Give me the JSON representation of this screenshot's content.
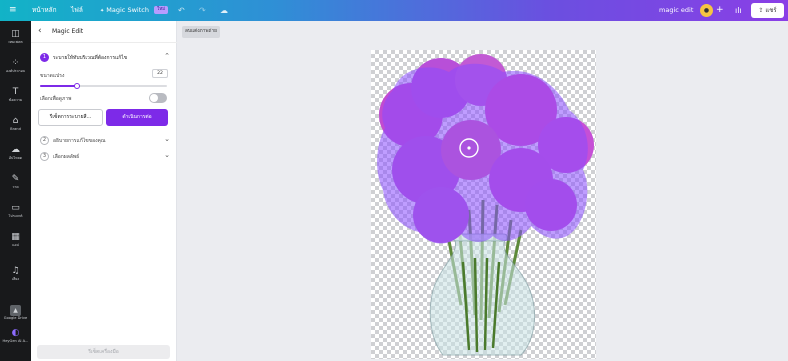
{
  "topbar": {
    "menu_icon": "hamburger-icon",
    "home": "หน้าหลัก",
    "file": "ไฟล์",
    "magic_switch": "Magic Switch",
    "magic_switch_badge": "ใหม่",
    "doc_title": "magic edit",
    "share": "แชร์"
  },
  "nav": [
    {
      "icon": "template-icon",
      "glyph": "◫",
      "label": "เทมเพลต"
    },
    {
      "icon": "elements-icon",
      "glyph": "⁘",
      "label": "องค์ประกอบ"
    },
    {
      "icon": "text-icon",
      "glyph": "T",
      "label": "ข้อความ"
    },
    {
      "icon": "brand-icon",
      "glyph": "⌂",
      "label": "Brand"
    },
    {
      "icon": "upload-icon",
      "glyph": "☁",
      "label": "อัปโหลด"
    },
    {
      "icon": "draw-icon",
      "glyph": "✎",
      "label": "วาด"
    },
    {
      "icon": "projects-icon",
      "glyph": "▭",
      "label": "โปรเจกต์"
    },
    {
      "icon": "apps-icon",
      "glyph": "▦",
      "label": "แอป"
    },
    {
      "icon": "audio-icon",
      "glyph": "♫",
      "label": "เสียง"
    },
    {
      "icon": "google-drive-icon",
      "glyph": "▲",
      "label": "Google Drive"
    },
    {
      "icon": "heygen-icon",
      "glyph": "◐",
      "label": "HeyGen AI A..."
    }
  ],
  "panel": {
    "title": "Magic Edit",
    "step1": {
      "num": "1",
      "label": "ระบายให้ทับบริเวณที่ต้องการแก้ไข"
    },
    "brush_label": "ขนาดแปรง",
    "brush_value": "22",
    "brush_level": 0.28,
    "preview_label": "เลือกเพื่อดูภาพ",
    "reset_button": "รีเซ็ตการระบายสี...",
    "continue_button": "ดำเนินการต่อ",
    "step2": {
      "num": "2",
      "label": "อธิบายการแก้ไขของคุณ"
    },
    "step3": {
      "num": "3",
      "label": "เลือกผลลัพธ์"
    },
    "footer_button": "รีเซ็ตเครื่องมือ"
  },
  "canvas": {
    "chip": "ลบแต่งภาพถ่าย"
  },
  "colors": {
    "accent": "#7d2ae8",
    "mask": "#8b4dff"
  }
}
